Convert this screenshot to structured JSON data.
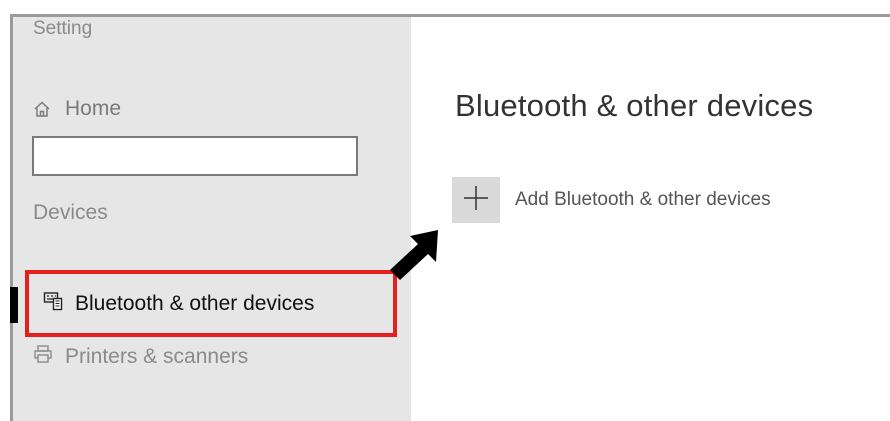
{
  "sidebar": {
    "title": "Setting",
    "home": {
      "label": "Home",
      "icon": "home-icon"
    },
    "search": {
      "value": "",
      "placeholder": ""
    },
    "section_label": "Devices",
    "items": [
      {
        "label": "Bluetooth & other devices",
        "icon": "keyboard-device-icon",
        "selected": true
      },
      {
        "label": "Printers & scanners",
        "icon": "printer-icon",
        "selected": false
      }
    ]
  },
  "main": {
    "title": "Bluetooth & other devices",
    "add_button": {
      "label": "Add Bluetooth & other devices",
      "icon": "plus-icon"
    }
  },
  "colors": {
    "sidebar_bg": "#e6e6e6",
    "highlight_border": "#e51e1e",
    "add_tile_bg": "#d9d9d9",
    "selected_indicator": "#000000"
  }
}
